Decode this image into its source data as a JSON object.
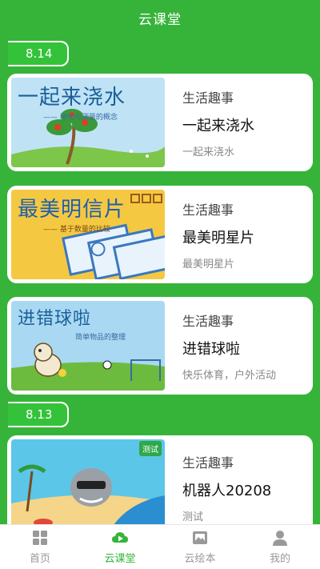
{
  "header": {
    "title": "云课堂"
  },
  "groups": [
    {
      "date": "8.14",
      "cards": [
        {
          "category": "生活趣事",
          "title": "一起来浇水",
          "desc": "一起来浇水",
          "thumb_title": "一起来浇水",
          "thumb_sub": "—— 种化与测量的概念"
        },
        {
          "category": "生活趣事",
          "title": "最美明星片",
          "desc": "最美明星片",
          "thumb_title": "最美明信片",
          "thumb_sub": "—— 基于数量的比较"
        },
        {
          "category": "生活趣事",
          "title": "进错球啦",
          "desc": "快乐体育，户外活动",
          "thumb_title": "进错球啦",
          "thumb_sub": "简单物品的整理"
        }
      ]
    },
    {
      "date": "8.13",
      "cards": [
        {
          "category": "生活趣事",
          "title": "机器人20208",
          "desc": "测试",
          "thumb_tag": "测试"
        }
      ]
    }
  ],
  "tabbar": [
    {
      "label": "首页",
      "icon": "home-grid-icon",
      "active": false
    },
    {
      "label": "云课堂",
      "icon": "cloud-play-icon",
      "active": true
    },
    {
      "label": "云绘本",
      "icon": "picture-book-icon",
      "active": false
    },
    {
      "label": "我的",
      "icon": "user-icon",
      "active": false
    }
  ],
  "colors": {
    "brand_green": "#36B43A",
    "inactive_gray": "#999999"
  }
}
